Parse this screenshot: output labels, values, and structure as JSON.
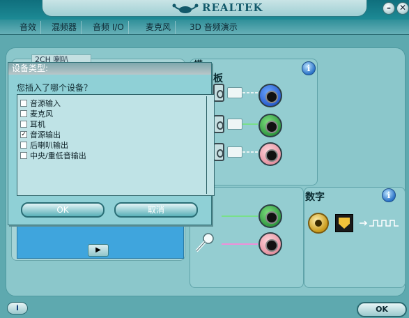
{
  "header": {
    "brand": "REALTEK",
    "minimize_label": "–",
    "close_label": "✕"
  },
  "tabs": [
    "音效",
    "混频器",
    "音频 I/O",
    "麦克风",
    "3D 音频演示"
  ],
  "left_panel": {
    "speaker_label": "2CH 喇叭"
  },
  "rear_panel": {
    "title": "板",
    "title_partial": "模"
  },
  "digital_panel": {
    "title": "数字"
  },
  "dialog": {
    "title": "设备类型:",
    "question": "您插入了哪个设备？",
    "options": [
      {
        "label": "音源输入",
        "checked": false
      },
      {
        "label": "麦克风",
        "checked": false
      },
      {
        "label": "耳机",
        "checked": false
      },
      {
        "label": "音源输出",
        "checked": true
      },
      {
        "label": "后喇叭输出",
        "checked": false
      },
      {
        "label": "中央/重低音输出",
        "checked": false
      }
    ],
    "ok_label": "OK",
    "cancel_label": "取消"
  },
  "footer": {
    "ok_label": "OK",
    "info_label": "i"
  },
  "colors": {
    "jack_blue": "#1040b8",
    "jack_green": "#117a27",
    "jack_pink": "#d9798a",
    "background": "#5ea9af"
  }
}
